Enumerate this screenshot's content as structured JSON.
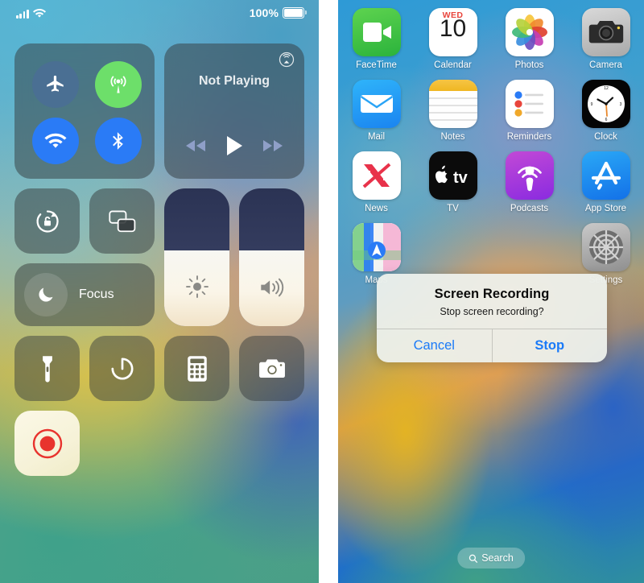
{
  "left_panel": {
    "name": "iOS Control Center",
    "status_bar": {
      "cellular_icon": "signal-bars-icon",
      "wifi_icon": "wifi-icon",
      "battery_percent": "100%",
      "battery_icon": "battery-full-icon"
    },
    "connectivity": {
      "airplane_mode": {
        "label": "Airplane Mode",
        "icon": "airplane-icon",
        "state": "off",
        "color": "#4a6f93"
      },
      "cellular_data": {
        "label": "Cellular Data",
        "icon": "cellular-antenna-icon",
        "state": "on",
        "color": "#6ddf6a"
      },
      "wifi": {
        "label": "Wi-Fi",
        "icon": "wifi-icon",
        "state": "on",
        "color": "#2a7bf6"
      },
      "bluetooth": {
        "label": "Bluetooth",
        "icon": "bluetooth-icon",
        "state": "on",
        "color": "#2a7bf6"
      }
    },
    "media": {
      "title": "Not Playing",
      "airplay_icon": "airplay-audio-icon",
      "rewind_icon": "rewind-icon",
      "play_icon": "play-icon",
      "forward_icon": "fast-forward-icon"
    },
    "toggles": {
      "rotation_lock": {
        "label": "Rotation Lock",
        "icon": "rotation-lock-icon"
      },
      "screen_mirroring": {
        "label": "Screen Mirroring",
        "icon": "screen-mirroring-icon"
      },
      "focus": {
        "label": "Focus",
        "icon": "moon-icon"
      }
    },
    "sliders": {
      "brightness": {
        "label": "Brightness",
        "icon": "brightness-sun-icon",
        "value": 55
      },
      "volume": {
        "label": "Volume",
        "icon": "speaker-wave-icon",
        "value": 55
      }
    },
    "shortcuts": [
      {
        "label": "Flashlight",
        "icon": "flashlight-icon"
      },
      {
        "label": "Timer",
        "icon": "timer-icon"
      },
      {
        "label": "Calculator",
        "icon": "calculator-icon"
      },
      {
        "label": "Camera",
        "icon": "camera-icon"
      }
    ],
    "screen_record": {
      "label": "Screen Recording",
      "icon": "record-icon",
      "state": "active",
      "color": "#e8332e"
    }
  },
  "right_panel": {
    "name": "iOS Home Screen",
    "app_rows": [
      [
        {
          "label": "FaceTime",
          "icon": "facetime-icon"
        },
        {
          "label": "Calendar",
          "icon": "calendar-icon",
          "day_of_week": "WED",
          "day": "10"
        },
        {
          "label": "Photos",
          "icon": "photos-icon"
        },
        {
          "label": "Camera",
          "icon": "camera-icon"
        }
      ],
      [
        {
          "label": "Mail",
          "icon": "mail-icon"
        },
        {
          "label": "Notes",
          "icon": "notes-icon"
        },
        {
          "label": "Reminders",
          "icon": "reminders-icon"
        },
        {
          "label": "Clock",
          "icon": "clock-icon"
        }
      ],
      [
        {
          "label": "News",
          "icon": "news-icon"
        },
        {
          "label": "TV",
          "icon": "apple-tv-icon"
        },
        {
          "label": "Podcasts",
          "icon": "podcasts-icon"
        },
        {
          "label": "App Store",
          "icon": "app-store-icon"
        }
      ],
      [
        {
          "label": "Maps",
          "icon": "maps-icon"
        },
        {
          "label": "",
          "icon": ""
        },
        {
          "label": "",
          "icon": ""
        },
        {
          "label": "Settings",
          "icon": "settings-icon"
        }
      ]
    ],
    "alert": {
      "title": "Screen Recording",
      "message": "Stop screen recording?",
      "cancel_label": "Cancel",
      "confirm_label": "Stop",
      "accent_color": "#1a7af8"
    },
    "search": {
      "label": "Search",
      "icon": "search-icon"
    }
  }
}
